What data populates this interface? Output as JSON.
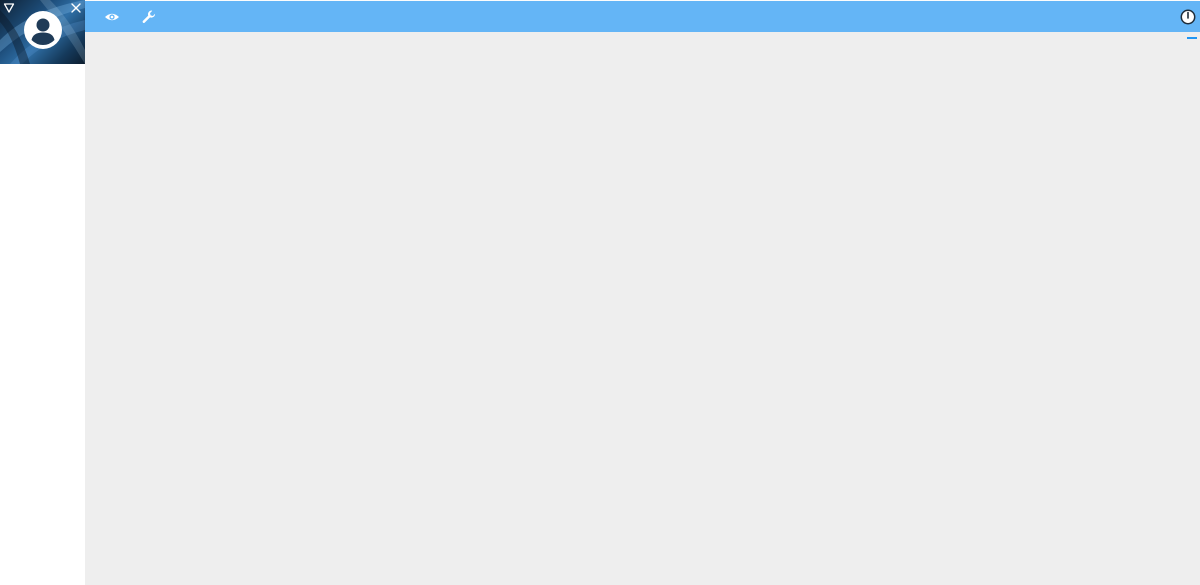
{
  "colors": {
    "topbar": "#64b5f6",
    "main_background": "#eeeeee",
    "sidebar_background": "#ffffff",
    "accent": "#2196f3"
  },
  "sidebar": {
    "profile": {
      "avatar_icon": "account-circle-icon",
      "menu_toggle_icon": "triangle-down-icon",
      "close_icon": "close-icon"
    }
  },
  "topbar": {
    "icons": [
      "eye-icon",
      "wrench-icon"
    ],
    "right_icon": "power-icon"
  }
}
